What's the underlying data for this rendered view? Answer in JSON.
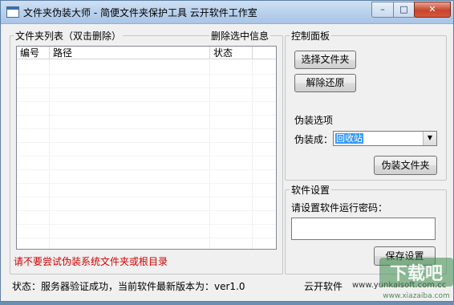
{
  "window": {
    "title": "文件夹伪装大师 - 简便文件夹保护工具 云开软件工作室",
    "minimize_glyph": "–",
    "maximize_glyph": "□",
    "close_glyph": "✕"
  },
  "folder_list": {
    "group_title": "文件夹列表（双击删除）",
    "delete_selected_label": "删除选中信息",
    "columns": [
      "编号",
      "路径",
      "状态"
    ],
    "rows": []
  },
  "control_panel": {
    "group_title": "控制面板",
    "select_folder_button": "选择文件夹",
    "unlock_restore_button": "解除还原",
    "disguise_options_label": "伪装选项",
    "disguise_as_label": "伪装成：",
    "disguise_as_value": "回收站",
    "disguise_folder_button": "伪装文件夹"
  },
  "software_settings": {
    "group_title": "软件设置",
    "password_prompt": "请设置软件运行密码：",
    "password_value": "",
    "save_button": "保存设置"
  },
  "warning_text": "请不要尝试伪装系统文件夹或根目录",
  "status": {
    "text": "状态：服务器验证成功，当前软件最新版本为：ver1.0",
    "brand": "云开软件",
    "website": "www.yunkaisoft.com.cc"
  },
  "watermark": {
    "logo_text": "下载吧",
    "url": "www.xiazaiba.com"
  },
  "colors": {
    "warning": "#d40000",
    "selection": "#3399ff"
  }
}
